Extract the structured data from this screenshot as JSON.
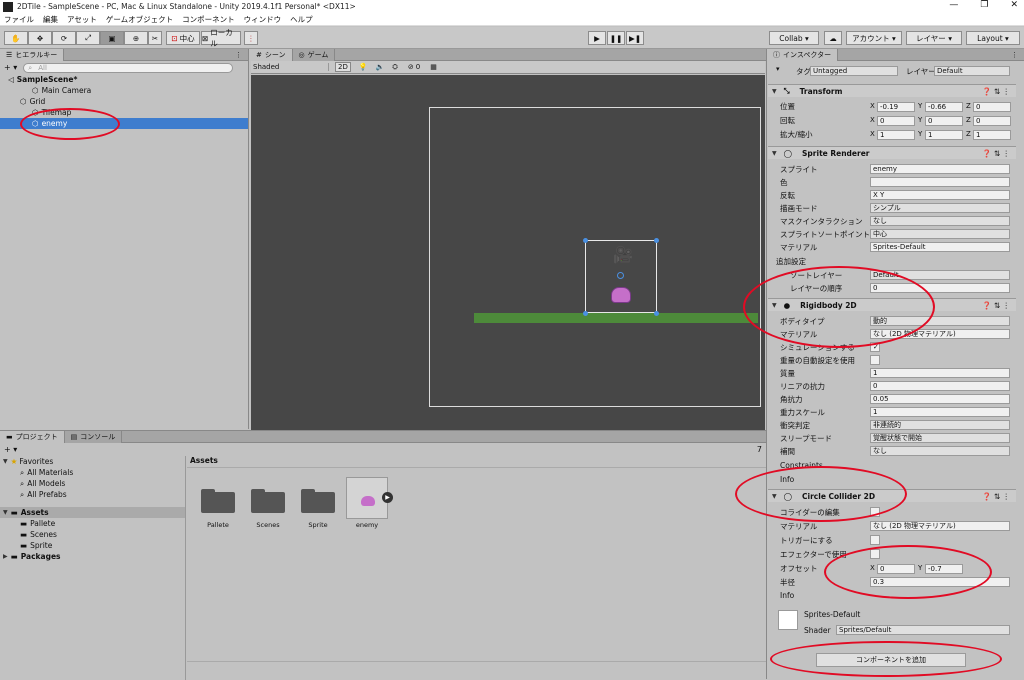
{
  "title": "2DTile - SampleScene - PC, Mac & Linux Standalone - Unity 2019.4.1f1 Personal* <DX11>",
  "win_controls": [
    "—",
    "❐",
    "✕"
  ],
  "menu": [
    "ファイル",
    "編集",
    "アセット",
    "ゲームオブジェクト",
    "コンポーネント",
    "ウィンドウ",
    "ヘルプ"
  ],
  "toolbar": {
    "center_label": "中心",
    "local_label": "ローカル",
    "collab": "Collab ▾",
    "account": "アカウント ▾",
    "layer": "レイヤー ▾",
    "layout": "Layout ▾"
  },
  "hierarchy": {
    "tab": "ヒエラルキー",
    "add": "+ ▾",
    "search": "All",
    "items": [
      {
        "label": "SampleScene*",
        "indent": 0,
        "bold": true
      },
      {
        "label": "Main Camera",
        "indent": 2
      },
      {
        "label": "Grid",
        "indent": 1
      },
      {
        "label": "Tilemap",
        "indent": 2
      },
      {
        "label": "enemy",
        "indent": 2,
        "selected": true
      }
    ]
  },
  "scene": {
    "tab_scene": "シーン",
    "tab_game": "ゲーム",
    "shading": "Shaded",
    "mode2d": "2D",
    "gizmo_count": "0"
  },
  "project": {
    "tab_project": "プロジェクト",
    "tab_console": "コンソール",
    "add": "+ ▾",
    "badge": "7",
    "favorites": "Favorites",
    "fav_items": [
      "All Materials",
      "All Models",
      "All Prefabs"
    ],
    "assets": "Assets",
    "asset_items": [
      "Pallete",
      "Scenes",
      "Sprite"
    ],
    "packages": "Packages",
    "crumb": "Assets",
    "folders": [
      "Pallete",
      "Scenes",
      "Sprite",
      "enemy"
    ]
  },
  "inspector": {
    "tab": "インスペクター",
    "tag_label": "タグ",
    "tag_value": "Untagged",
    "layer_label": "レイヤー",
    "layer_value": "Default",
    "transform": {
      "name": "Transform",
      "rows": [
        {
          "label": "位置",
          "x": "-0.19",
          "y": "-0.66",
          "z": "0"
        },
        {
          "label": "回転",
          "x": "0",
          "y": "0",
          "z": "0"
        },
        {
          "label": "拡大/縮小",
          "x": "1",
          "y": "1",
          "z": "1"
        }
      ]
    },
    "sprite_renderer": {
      "name": "Sprite Renderer",
      "rows": [
        {
          "label": "スプライト",
          "value": "enemy"
        },
        {
          "label": "色",
          "value": ""
        },
        {
          "label": "反転",
          "value": "X    Y"
        },
        {
          "label": "描画モード",
          "value": "シンプル"
        },
        {
          "label": "マスクインタラクション",
          "value": "なし"
        },
        {
          "label": "スプライトソートポイント",
          "value": "中心"
        },
        {
          "label": "マテリアル",
          "value": "Sprites-Default"
        }
      ],
      "extra": "追加設定",
      "sort_layer_label": "ソートレイヤー",
      "sort_layer": "Default",
      "order_label": "レイヤーの順序",
      "order": "0"
    },
    "rigidbody": {
      "name": "Rigidbody 2D",
      "rows": [
        {
          "label": "ボディタイプ",
          "value": "動的"
        },
        {
          "label": "マテリアル",
          "value": "なし (2D 物理マテリアル)"
        },
        {
          "label": "シミュレーションする",
          "value": "✓"
        },
        {
          "label": "重量の自動設定を使用",
          "value": ""
        },
        {
          "label": "質量",
          "value": "1"
        },
        {
          "label": "リニアの抗力",
          "value": "0"
        },
        {
          "label": "角抗力",
          "value": "0.05"
        },
        {
          "label": "重力スケール",
          "value": "1"
        },
        {
          "label": "衝突判定",
          "value": "非連続的"
        },
        {
          "label": "スリープモード",
          "value": "覚醒状態で開始"
        },
        {
          "label": "補間",
          "value": "なし"
        }
      ],
      "constraints": "Constraints",
      "info": "Info"
    },
    "circle": {
      "name": "Circle Collider 2D",
      "rows": [
        {
          "label": "コライダーの編集",
          "value": ""
        },
        {
          "label": "マテリアル",
          "value": "なし (2D 物理マテリアル)"
        },
        {
          "label": "トリガーにする",
          "value": ""
        },
        {
          "label": "エフェクターで使用",
          "value": ""
        },
        {
          "label": "オフセット",
          "x": "0",
          "y": "-0.7"
        },
        {
          "label": "半径",
          "value": "0.3"
        }
      ],
      "info": "Info"
    },
    "material": {
      "name": "Sprites-Default",
      "shader_label": "Shader",
      "shader": "Sprites/Default"
    },
    "add_component": "コンポーネントを追加"
  },
  "colors": {
    "accent_selected": "#3e7dce",
    "annotation": "#e10b24",
    "ground": "#4d8a3a"
  }
}
